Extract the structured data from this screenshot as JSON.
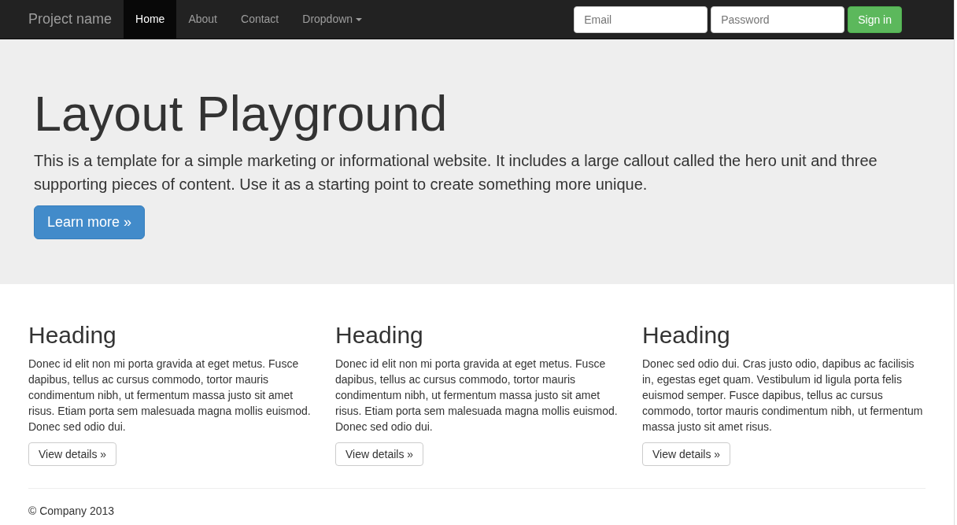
{
  "navbar": {
    "brand": "Project name",
    "items": [
      {
        "label": "Home",
        "selected": true,
        "dropdown": false
      },
      {
        "label": "About",
        "selected": false,
        "dropdown": false
      },
      {
        "label": "Contact",
        "selected": false,
        "dropdown": false
      },
      {
        "label": "Dropdown",
        "selected": false,
        "dropdown": true
      }
    ],
    "email": {
      "placeholder": "Email"
    },
    "password": {
      "placeholder": "Password"
    },
    "sign_in": "Sign in"
  },
  "hero": {
    "title": "Layout Playground",
    "text": "This is a template for a simple marketing or informational website. It includes a large callout called the hero unit and three supporting pieces of content. Use it as a starting point to create something more unique.",
    "button": "Learn more »"
  },
  "columns": [
    {
      "heading": "Heading",
      "text": "Donec id elit non mi porta gravida at eget metus. Fusce dapibus, tellus ac cursus commodo, tortor mauris condimentum nibh, ut fermentum massa justo sit amet risus. Etiam porta sem malesuada magna mollis euismod. Donec sed odio dui.",
      "button": "View details »"
    },
    {
      "heading": "Heading",
      "text": "Donec id elit non mi porta gravida at eget metus. Fusce dapibus, tellus ac cursus commodo, tortor mauris condimentum nibh, ut fermentum massa justo sit amet risus. Etiam porta sem malesuada magna mollis euismod. Donec sed odio dui.",
      "button": "View details »"
    },
    {
      "heading": "Heading",
      "text": "Donec sed odio dui. Cras justo odio, dapibus ac facilisis in, egestas eget quam. Vestibulum id ligula porta felis euismod semper. Fusce dapibus, tellus ac cursus commodo, tortor mauris condimentum nibh, ut fermentum massa justo sit amet risus.",
      "button": "View details »"
    }
  ],
  "footer": "© Company 2013"
}
